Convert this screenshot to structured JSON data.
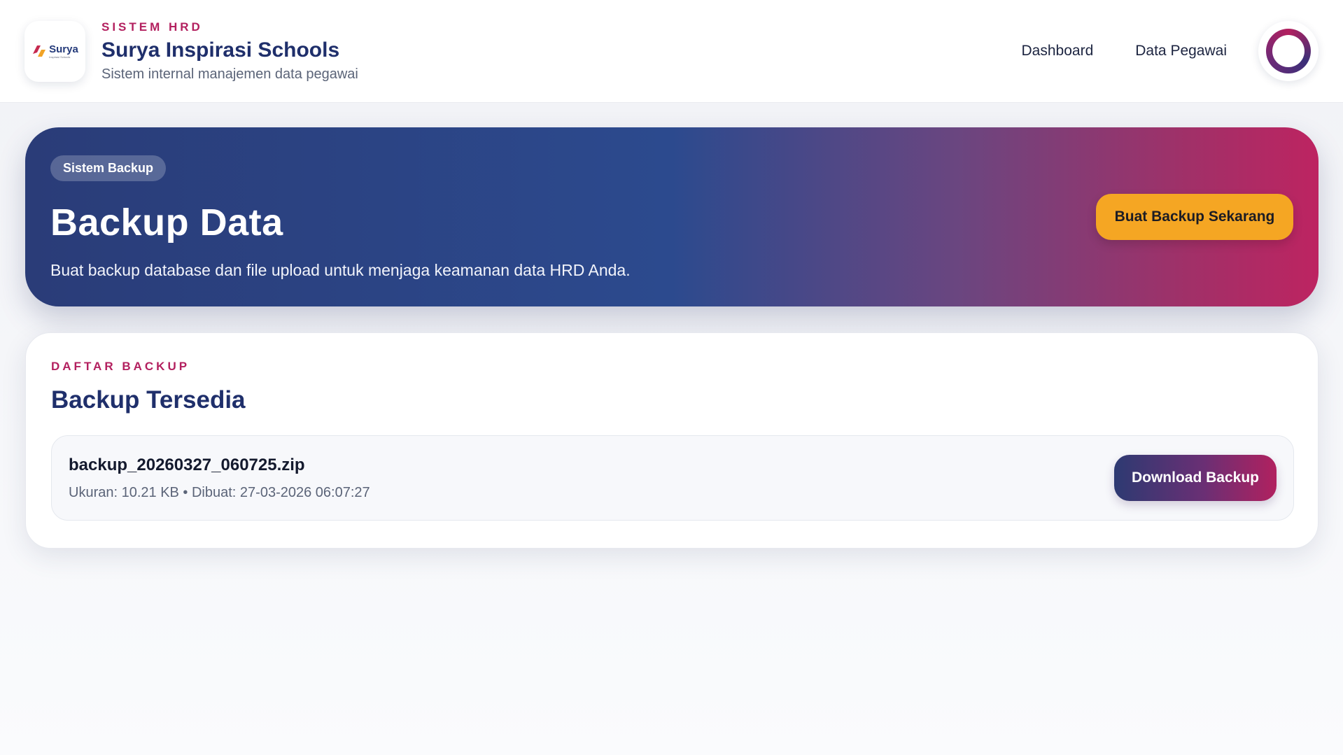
{
  "header": {
    "logo": {
      "word": "Surya",
      "tagline": "Inspirasi Schools"
    },
    "kicker": "SISTEM HRD",
    "title": "Surya Inspirasi Schools",
    "subtitle": "Sistem internal manajemen data pegawai",
    "nav": [
      {
        "label": "Dashboard"
      },
      {
        "label": "Data Pegawai"
      }
    ]
  },
  "hero": {
    "badge": "Sistem Backup",
    "title": "Backup Data",
    "description": "Buat backup database dan file upload untuk menjaga keamanan data HRD Anda.",
    "action_label": "Buat Backup Sekarang"
  },
  "backups": {
    "kicker": "DAFTAR BACKUP",
    "title": "Backup Tersedia",
    "items": [
      {
        "file_name": "backup_20260327_060725.zip",
        "meta": "Ukuran: 10.21 KB • Dibuat: 27-03-2026 06:07:27",
        "download_label": "Download Backup"
      }
    ]
  },
  "colors": {
    "accent_pink": "#b3205f",
    "navy": "#1f2f6b",
    "primary_button": "#f5a623"
  },
  "icons": {
    "logo": "surya-logo-icon",
    "avatar": "user-avatar-icon"
  }
}
